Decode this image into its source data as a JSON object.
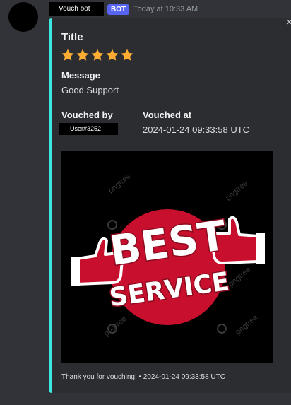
{
  "message": {
    "author": "Vouch bot",
    "bot_tag": "BOT",
    "timestamp": "Today at 10:33 AM"
  },
  "embed": {
    "accent_color": "#3ce8e0",
    "title": "Title",
    "stars": "★★★★★",
    "rating": 5,
    "fields": {
      "message_label": "Message",
      "message_value": "Good Support",
      "vouched_by_label": "Vouched by",
      "vouched_by_value": "User#3252",
      "vouched_at_label": "Vouched at",
      "vouched_at_value": "2024-01-24 09:33:58 UTC"
    },
    "image": {
      "line1": "BEST",
      "line2": "SERVICE",
      "watermark": "pngtree"
    },
    "footer": "Thank you for vouching! • 2024-01-24 09:33:58 UTC"
  },
  "controls": {
    "close_icon": "close-icon"
  }
}
